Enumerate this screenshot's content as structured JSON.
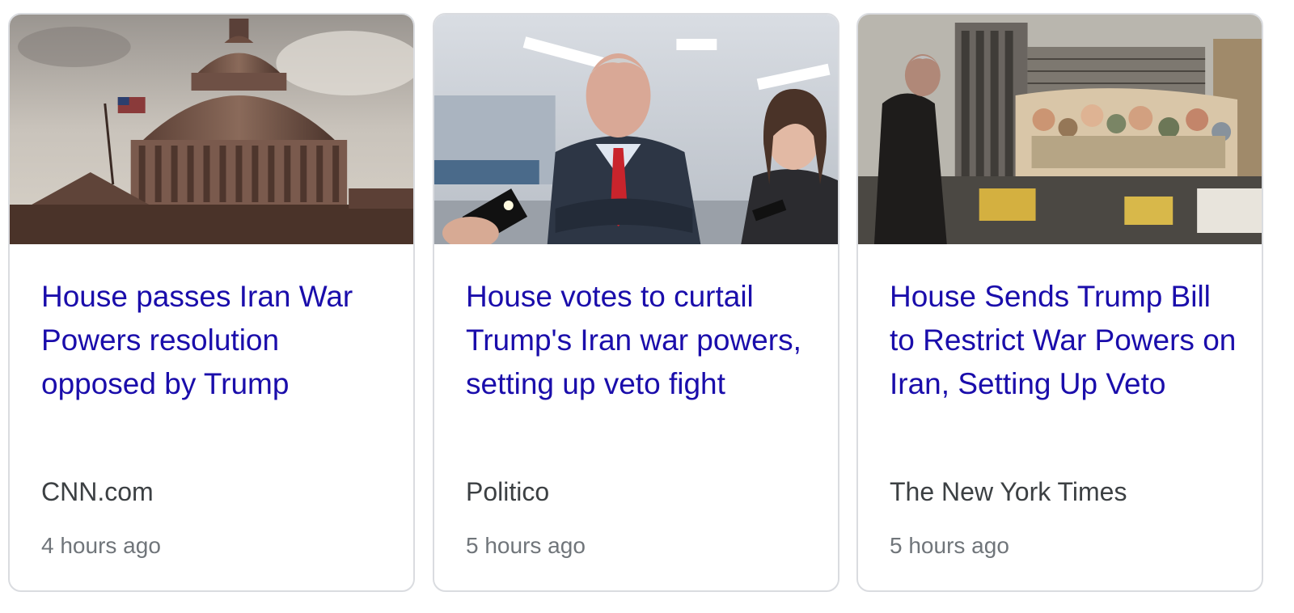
{
  "cards": [
    {
      "image_icon": "capitol-dome-photo",
      "headline": "House passes Iran War Powers resolution opposed by Trump",
      "source": "CNN.com",
      "time": "4 hours ago"
    },
    {
      "image_icon": "senator-interview-photo",
      "headline": "House votes to curtail Trump's Iran war powers, setting up veto fight",
      "source": "Politico",
      "time": "5 hours ago"
    },
    {
      "image_icon": "tehran-street-mural-photo",
      "headline": "House Sends Trump Bill to Restrict War Powers on Iran, Setting Up Veto",
      "source": "The New York Times",
      "time": "5 hours ago"
    }
  ],
  "colors": {
    "headline": "#1a0dab",
    "source": "#3c4043",
    "time": "#70757a",
    "card_border": "#dadce0"
  }
}
